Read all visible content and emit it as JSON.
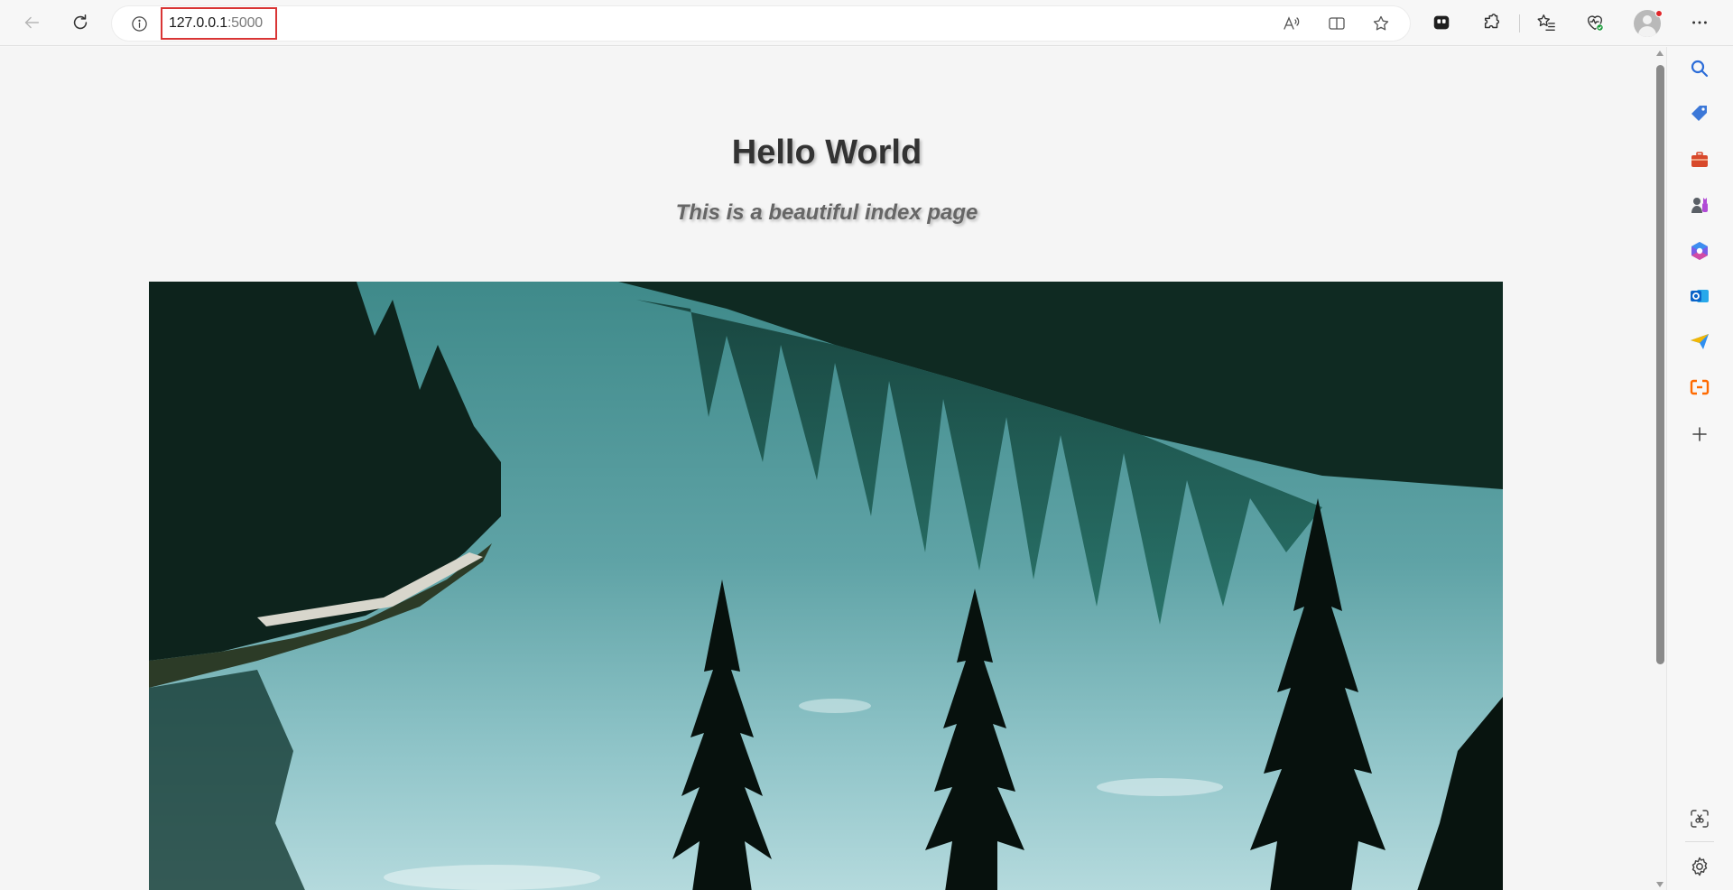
{
  "browser": {
    "address_bar": {
      "host": "127.0.0.1",
      "port": ":5000"
    }
  },
  "page": {
    "title": "Hello World",
    "subtitle": "This is a beautiful index page"
  },
  "colors": {
    "address_highlight": "#d93535",
    "profile_badge": "#e0262a"
  },
  "icons": {
    "toolbar": [
      "back-arrow-icon",
      "refresh-icon",
      "site-info-icon",
      "read-aloud-icon",
      "split-screen-icon",
      "favorite-star-icon",
      "collections-icon",
      "extensions-icon",
      "favorites-icon",
      "browser-essentials-icon",
      "profile-avatar-icon",
      "more-menu-icon"
    ],
    "sidebar": [
      "search-icon",
      "shopping-tag-icon",
      "tools-briefcase-icon",
      "games-icon",
      "microsoft-365-icon",
      "outlook-icon",
      "drop-send-icon",
      "alibaba-cloud-icon",
      "add-icon",
      "screenshot-icon",
      "settings-gear-icon"
    ]
  }
}
